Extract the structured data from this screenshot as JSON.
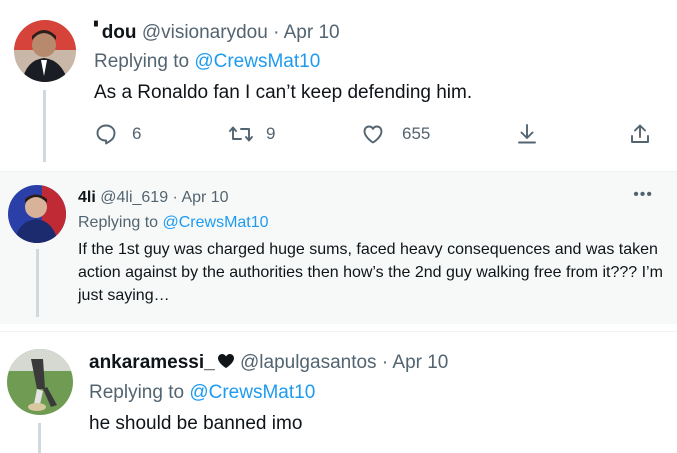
{
  "tweets": [
    {
      "name": "dou",
      "name_prefix": "▘",
      "handle": "@visionarydou",
      "date": "Apr 10",
      "replying_label": "Replying to",
      "replying_to": "@CrewsMat10",
      "text": "As a Ronaldo fan I can’t keep defending him.",
      "actions": {
        "replies": "6",
        "retweets": "9",
        "likes": "655"
      }
    },
    {
      "name": "4li",
      "handle": "@4li_619",
      "date": "Apr 10",
      "replying_label": "Replying to",
      "replying_to": "@CrewsMat10",
      "text": "If the 1st guy was charged huge sums, faced heavy consequences and was taken action against by the authorities then how’s the 2nd guy walking free from it??? I’m just saying…",
      "more": "•••"
    },
    {
      "name": "ankaramessi_",
      "handle": "@lapulgasantos",
      "date": "Apr 10",
      "replying_label": "Replying to",
      "replying_to": "@CrewsMat10",
      "text": "he should be banned imo"
    }
  ],
  "separator": "·",
  "colors": {
    "accent": "#1d9bf0",
    "muted": "#536471",
    "text": "#0f1419",
    "hover_bg": "#f7f9f9"
  }
}
